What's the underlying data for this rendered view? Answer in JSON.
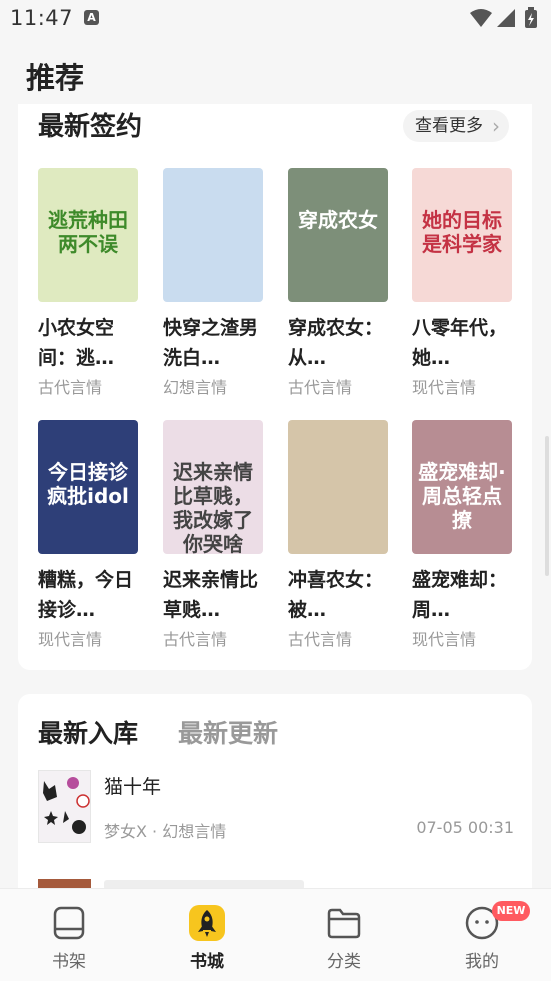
{
  "status_bar": {
    "time": "11:47",
    "notification_letter": "A"
  },
  "page": {
    "title": "推荐"
  },
  "latest_signed": {
    "title": "最新签约",
    "more_label": "查看更多",
    "books": [
      {
        "title": "小农女空间：逃荒种田两不误",
        "display_title": "小农女空间：逃…",
        "genre": "古代言情",
        "cover_text": "逃荒种田两不误",
        "cover_bg": "#dfeac0",
        "cover_fg": "#3e8a2a"
      },
      {
        "title": "快穿之渣男洗白",
        "display_title": "快穿之渣男洗白…",
        "genre": "幻想言情",
        "cover_text": "",
        "cover_bg": "#c9dcef",
        "cover_fg": "#2b4c80"
      },
      {
        "title": "穿成农女：从新婚…",
        "display_title": "穿成农女：从…",
        "genre": "古代言情",
        "cover_text": "穿成农女",
        "cover_bg": "#7d8f79",
        "cover_fg": "#ffffff"
      },
      {
        "title": "八零年代，她的目标是科学家",
        "display_title": "八零年代，她…",
        "genre": "现代言情",
        "cover_text": "她的目标是科学家",
        "cover_bg": "#f6d9d6",
        "cover_fg": "#c43244"
      },
      {
        "title": "糟糕，今日接诊疯批idol",
        "display_title": "糟糕，今日接诊…",
        "genre": "现代言情",
        "cover_text": "今日接诊疯批idol",
        "cover_bg": "#2e3f78",
        "cover_fg": "#ffffff"
      },
      {
        "title": "迟来亲情比草贱，我改嫁了你哭啥",
        "display_title": "迟来亲情比草贱…",
        "genre": "古代言情",
        "cover_text": "迟来亲情比草贱，我改嫁了你哭啥",
        "cover_bg": "#ecdde6",
        "cover_fg": "#444444"
      },
      {
        "title": "冲喜农女：被…",
        "display_title": "冲喜农女：被…",
        "genre": "古代言情",
        "cover_text": "",
        "cover_bg": "#d5c5a9",
        "cover_fg": "#a03030"
      },
      {
        "title": "盛宠难却：周总轻点撩",
        "display_title": "盛宠难却：周…",
        "genre": "现代言情",
        "cover_text": "盛宠难却·周总轻点撩",
        "cover_bg": "#b78d93",
        "cover_fg": "#ffffff"
      }
    ]
  },
  "library": {
    "tabs": [
      "最新入库",
      "最新更新"
    ],
    "entries": [
      {
        "title": "猫十年",
        "meta": "梦女X · 幻想言情",
        "time": "07-05 00:31"
      }
    ]
  },
  "nav": {
    "items": [
      {
        "label": "书架",
        "icon": "bookshelf-icon"
      },
      {
        "label": "书城",
        "icon": "rocket-icon"
      },
      {
        "label": "分类",
        "icon": "folder-icon"
      },
      {
        "label": "我的",
        "icon": "profile-icon"
      }
    ],
    "badge": "NEW"
  },
  "colors": {
    "accent_yellow": "#f7c51e",
    "badge_red": "#ff5a60"
  }
}
